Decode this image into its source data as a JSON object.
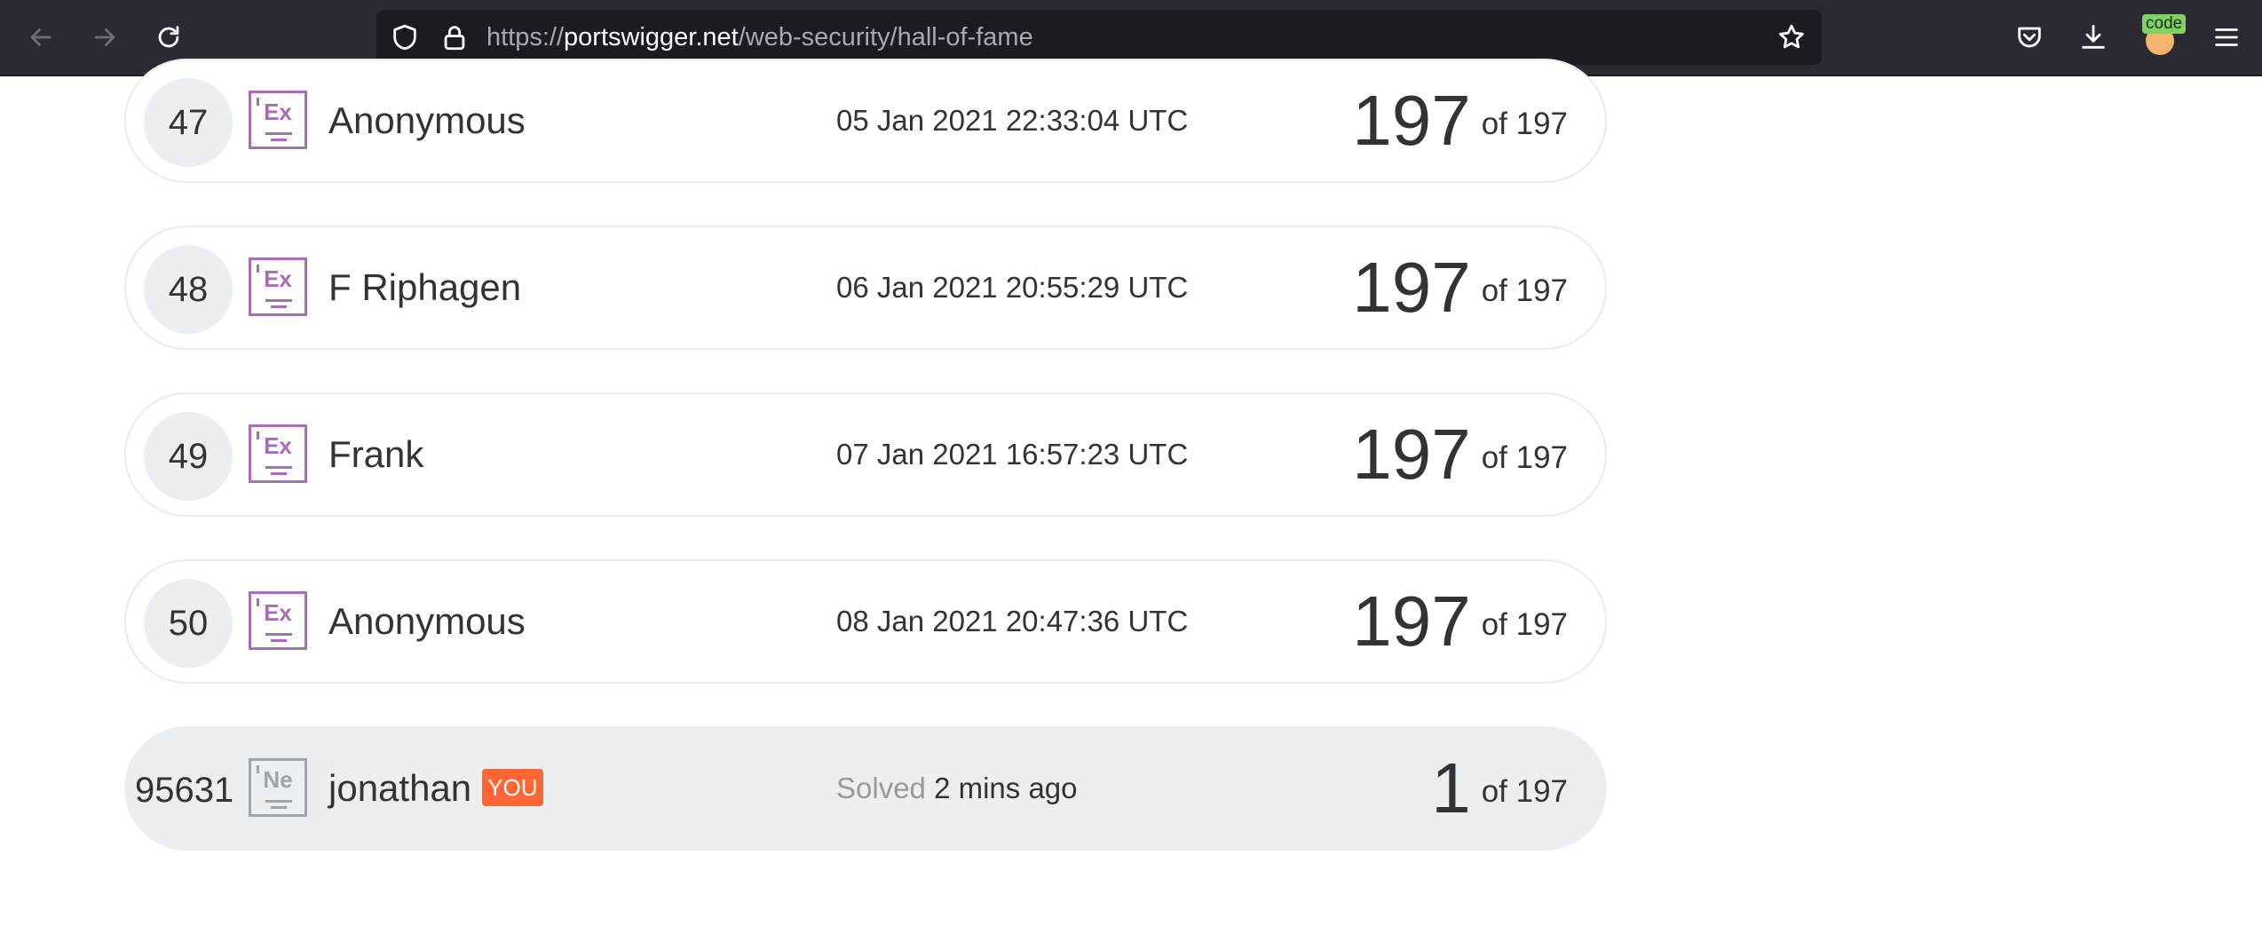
{
  "browser": {
    "url_scheme": "https://",
    "url_domain": "portswigger.net",
    "url_path": "/web-security/hall-of-fame",
    "avatar_badge": "code",
    "icons": {
      "back": "arrow-left-icon",
      "forward": "arrow-right-icon",
      "reload": "reload-icon",
      "shield": "shield-icon",
      "lock": "lock-icon",
      "bookmark": "star-icon",
      "pocket": "pocket-icon",
      "downloads": "download-icon",
      "menu": "hamburger-menu-icon"
    },
    "colors": {
      "toolbar": "#2b2a33",
      "urlbar": "#1c1b22"
    }
  },
  "leaderboard": {
    "rows": [
      {
        "rank": "47",
        "level": "Ex",
        "name": "Anonymous",
        "date": "05 Jan 2021 22:33:04 UTC",
        "score": "197",
        "of": "of 197"
      },
      {
        "rank": "48",
        "level": "Ex",
        "name": "F Riphagen",
        "date": "06 Jan 2021 20:55:29 UTC",
        "score": "197",
        "of": "of 197"
      },
      {
        "rank": "49",
        "level": "Ex",
        "name": "Frank",
        "date": "07 Jan 2021 16:57:23 UTC",
        "score": "197",
        "of": "of 197"
      },
      {
        "rank": "50",
        "level": "Ex",
        "name": "Anonymous",
        "date": "08 Jan 2021 20:47:36 UTC",
        "score": "197",
        "of": "of 197"
      }
    ],
    "current_user": {
      "rank": "95631",
      "level": "Ne",
      "name": "jonathan",
      "you_label": "YOU",
      "solved_label": "Solved",
      "solved_time": "2 mins ago",
      "score": "1",
      "of": "of 197"
    },
    "colors": {
      "expert_level": "#aa6bb8",
      "novice_level": "#9ea4a8",
      "you_tag": "#ff6633",
      "highlight_row": "#ebeff1"
    }
  }
}
